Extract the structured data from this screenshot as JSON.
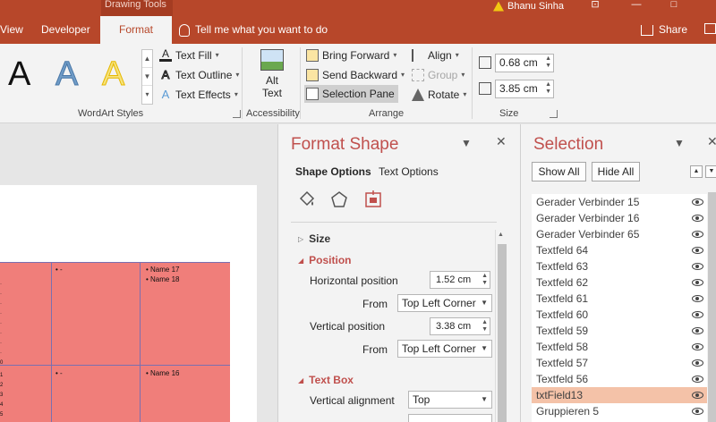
{
  "titlebar": {
    "context_label": "Drawing Tools",
    "user_name": "Bhanu Sinha"
  },
  "tabs": {
    "view": "View",
    "developer": "Developer",
    "format": "Format",
    "tell_me": "Tell me what you want to do",
    "share": "Share"
  },
  "ribbon": {
    "wordart": {
      "group_label": "WordArt Styles",
      "text_fill": "Text Fill",
      "text_outline": "Text Outline",
      "text_effects": "Text Effects",
      "sample_letter": "A"
    },
    "accessibility": {
      "group_label": "Accessibility",
      "alt_text_line1": "Alt",
      "alt_text_line2": "Text"
    },
    "arrange": {
      "group_label": "Arrange",
      "bring_forward": "Bring Forward",
      "send_backward": "Send Backward",
      "selection_pane": "Selection Pane",
      "align": "Align",
      "group": "Group",
      "rotate": "Rotate"
    },
    "size": {
      "group_label": "Size",
      "height": "0.68 cm",
      "width": "3.85 cm"
    }
  },
  "slide": {
    "cell_1": "Name 17",
    "cell_2": "Name 18",
    "cell_3": "Name 16",
    "dash_1": "-",
    "dash_2": "-"
  },
  "format_shape": {
    "title": "Format Shape",
    "tab_shape": "Shape Options",
    "tab_text": "Text Options",
    "size_section": "Size",
    "position_section": "Position",
    "horizontal_position_label": "Horizontal position",
    "horizontal_position_value": "1.52 cm",
    "from_label": "From",
    "horizontal_from": "Top Left Corner",
    "vertical_position_label": "Vertical position",
    "vertical_position_value": "3.38 cm",
    "vertical_from": "Top Left Corner",
    "textbox_section": "Text Box",
    "vertical_alignment_label": "Vertical alignment",
    "vertical_alignment_value": "Top"
  },
  "selection_pane": {
    "title": "Selection",
    "show_all": "Show All",
    "hide_all": "Hide All",
    "items": [
      {
        "label": "Gerader Verbinder 15"
      },
      {
        "label": "Gerader Verbinder 16"
      },
      {
        "label": "Gerader Verbinder 65"
      },
      {
        "label": "Textfeld 64"
      },
      {
        "label": "Textfeld 63"
      },
      {
        "label": "Textfeld 62"
      },
      {
        "label": "Textfeld 61"
      },
      {
        "label": "Textfeld 60"
      },
      {
        "label": "Textfeld 59"
      },
      {
        "label": "Textfeld 58"
      },
      {
        "label": "Textfeld 57"
      },
      {
        "label": "Textfeld 56"
      },
      {
        "label": "txtField13"
      },
      {
        "label": "Gruppieren 5"
      }
    ],
    "selected_item": "txtField13"
  },
  "colors": {
    "accent": "#b7472a",
    "pane_title": "#c0504d",
    "table_fill": "#f07e7a",
    "selected_row": "#f4c2a8"
  },
  "icons": [
    "warning-icon",
    "bulb-icon",
    "share-icon",
    "alt-text-icon",
    "fill-line-icon",
    "effects-icon",
    "layout-properties-icon",
    "eye-icon"
  ]
}
